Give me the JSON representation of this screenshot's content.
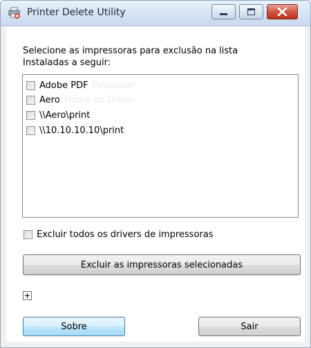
{
  "window": {
    "title": "Printer Delete Utility",
    "icon": "printer-delete-icon",
    "controls": {
      "minimize": "minimize-icon",
      "maximize": "maximize-icon",
      "close": "close-icon"
    }
  },
  "instructions": {
    "line1": "Selecione as impressoras para exclusão na lista",
    "line2": "Instaladas a seguir:"
  },
  "printers": [
    {
      "label": "Adobe PDF",
      "ghost": "Pesquisar",
      "checked": false
    },
    {
      "label": "Aero",
      "ghost": "Nome do Driver",
      "checked": false
    },
    {
      "label": "\\\\Aero\\print",
      "checked": false
    },
    {
      "label": "\\\\10.10.10.10\\print",
      "checked": false
    }
  ],
  "delete_all_drivers": {
    "label": "Excluir todos os drivers de impressoras",
    "checked": false
  },
  "buttons": {
    "delete_selected": "Excluir as impressoras selecionadas",
    "about": "Sobre",
    "exit": "Sair"
  },
  "colors": {
    "title_gradient_top": "#e9f1fb",
    "close_button": "#c8402a",
    "default_button_border": "#3c7fb1"
  }
}
